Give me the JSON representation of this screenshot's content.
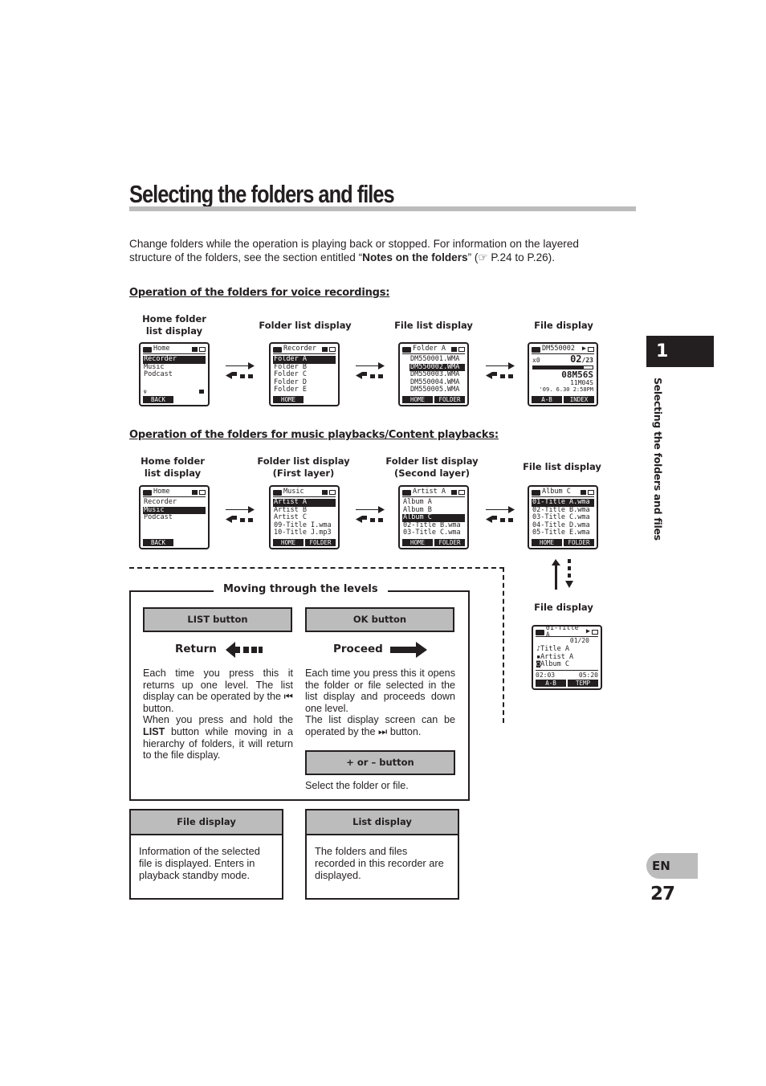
{
  "title": "Selecting the folders and files",
  "intro": {
    "text_before": "Change folders while the operation is playing back or stopped. For information on the layered structure of the folders, see the section entitled “",
    "bold": "Notes on the folders",
    "text_after": "” (☞ P.24 to P.26)."
  },
  "voice_section": {
    "heading": "Operation of the folders for voice recordings:",
    "captions": [
      "Home folder\nlist display",
      "Folder list display",
      "File list display",
      "File display"
    ],
    "screens": [
      {
        "header": "Home",
        "rows": [
          "Recorder",
          "Music",
          "Podcast"
        ],
        "selected": 0,
        "softkeys": [
          "BACK",
          ""
        ]
      },
      {
        "header": "Recorder",
        "rows": [
          "Folder A",
          "Folder B",
          "Folder C",
          "Folder D",
          "Folder E"
        ],
        "selected": 0,
        "softkeys": [
          "HOME",
          ""
        ]
      },
      {
        "header": "Folder A",
        "rows": [
          "DM550001.WMA",
          "DM550002.WMA",
          "DM550003.WMA",
          "DM550004.WMA",
          "DM550005.WMA"
        ],
        "selected": 1,
        "softkeys": [
          "HOME",
          "FOLDER"
        ]
      },
      {
        "header": "DM550002",
        "file_number": "02",
        "file_total": "23",
        "speed": "x0",
        "elapsed": "08M56S",
        "length": "11M04S",
        "date": "'09. 6.30  2:58PM",
        "softkeys": [
          "A-B",
          "INDEX"
        ]
      }
    ]
  },
  "music_section": {
    "heading": "Operation of the folders for music playbacks/Content playbacks:",
    "captions": [
      "Home folder\nlist display",
      "Folder list display\n(First layer)",
      "Folder list display\n(Second layer)",
      "File list display",
      "File display"
    ],
    "screens": [
      {
        "header": "Home",
        "rows": [
          "Recorder",
          "Music",
          "Podcast"
        ],
        "selected": 1,
        "softkeys": [
          "BACK",
          ""
        ]
      },
      {
        "header": "Music",
        "rows": [
          "Artist A",
          "Artist B",
          "Artist C",
          "09-Title I.wma",
          "10-Title J.mp3"
        ],
        "selected": 0,
        "softkeys": [
          "HOME",
          "FOLDER"
        ]
      },
      {
        "header": "Artist A",
        "rows": [
          "Album A",
          "Album B",
          "Album C",
          "02-Title B.wma",
          "03-Title C.wma"
        ],
        "selected": 2,
        "softkeys": [
          "HOME",
          "FOLDER"
        ]
      },
      {
        "header": "Album C",
        "rows": [
          "01-Title A.wma",
          "02-Title B.wma",
          "03-Title C.wma",
          "04-Title D.wma",
          "05-Title E.wma"
        ],
        "selected": 0,
        "softkeys": [
          "HOME",
          "FOLDER"
        ]
      },
      {
        "header": "01-Title A",
        "track": "01/20",
        "rows": [
          "Title A",
          "Artist A",
          "Album C"
        ],
        "elapsed": "02:03",
        "total": "05:20",
        "softkeys": [
          "A-B",
          "TEMP"
        ]
      }
    ]
  },
  "levels": {
    "title": "Moving through the levels",
    "list_button": "LIST button",
    "ok_button": "OK button",
    "return_label": "Return",
    "proceed_label": "Proceed",
    "return_text_1": "Each time you press this it returns up one level. The list display can be operated by the ⏮ button.",
    "return_text_2a": "When you press and hold the ",
    "return_text_2b": "LIST",
    "return_text_2c": " button while moving in a hierarchy of folders, it will return to the file display.",
    "proceed_text_1": "Each time you press this it opens the folder or file selected in the list display and proceeds down one level.",
    "proceed_text_2": "The list display screen can be operated by the ⏭ button.",
    "plusminus_button": "+ or – button",
    "plusminus_text": "Select the folder or file."
  },
  "info_boxes": [
    {
      "title": "File display",
      "text": "Information of the selected file is displayed. Enters in playback standby mode."
    },
    {
      "title": "List display",
      "text": "The folders and files recorded in this recorder are displayed."
    }
  ],
  "side": {
    "chapter": "1",
    "label": "Selecting the folders and files",
    "lang": "EN",
    "page": "27"
  }
}
